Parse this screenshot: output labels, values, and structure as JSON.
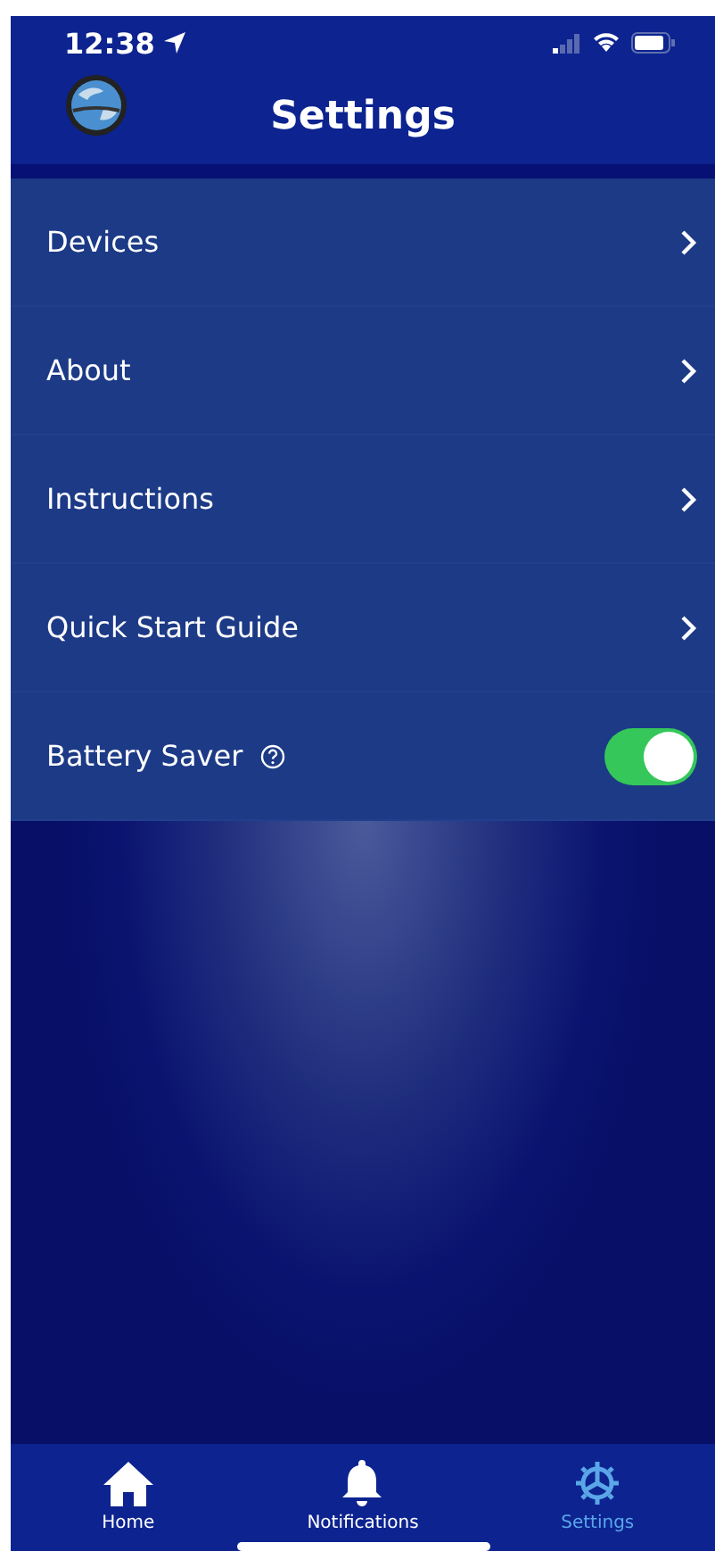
{
  "status_bar": {
    "time": "12:38"
  },
  "header": {
    "title": "Settings"
  },
  "settings": [
    {
      "kind": "link",
      "label": "Devices"
    },
    {
      "kind": "link",
      "label": "About"
    },
    {
      "kind": "link",
      "label": "Instructions"
    },
    {
      "kind": "link",
      "label": "Quick Start Guide"
    },
    {
      "kind": "toggle",
      "label": "Battery Saver",
      "help": true,
      "on": true
    }
  ],
  "tab_bar": [
    {
      "kind": "home",
      "label": "Home",
      "selected": false
    },
    {
      "kind": "bell",
      "label": "Notifications",
      "selected": false
    },
    {
      "kind": "gear",
      "label": "Settings",
      "selected": true
    }
  ]
}
